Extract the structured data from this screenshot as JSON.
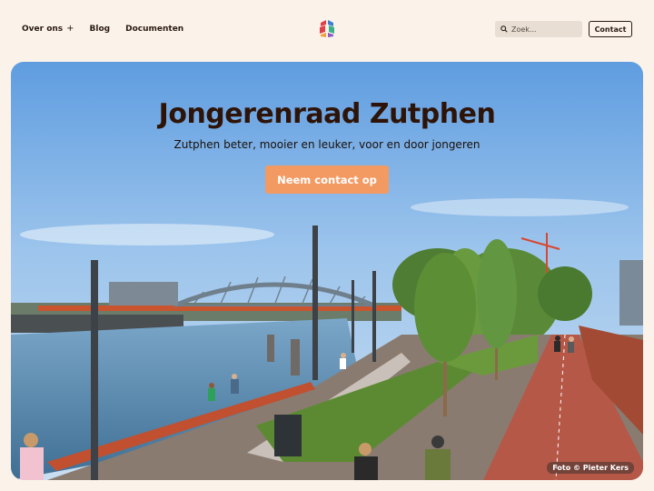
{
  "nav": {
    "links": [
      {
        "label": "Over ons",
        "has_submenu": true,
        "submenu_icon": "+"
      },
      {
        "label": "Blog"
      },
      {
        "label": "Documenten"
      }
    ],
    "logo_icon": "logo-icon",
    "search": {
      "placeholder": "Zoek...",
      "value": "",
      "icon": "search-icon"
    },
    "contact_label": "Contact"
  },
  "hero": {
    "title": "Jongerenraad Zutphen",
    "subtitle": "Zutphen beter, mooier en leuker, voor en door jongeren",
    "cta_label": "Neem contact op",
    "photo_credit": "Foto © Pieter Kers"
  },
  "colors": {
    "page_background": "#fbf3ea",
    "accent": "#f39a63",
    "text_dark": "#2a1a10",
    "search_background": "#e8ded4"
  }
}
